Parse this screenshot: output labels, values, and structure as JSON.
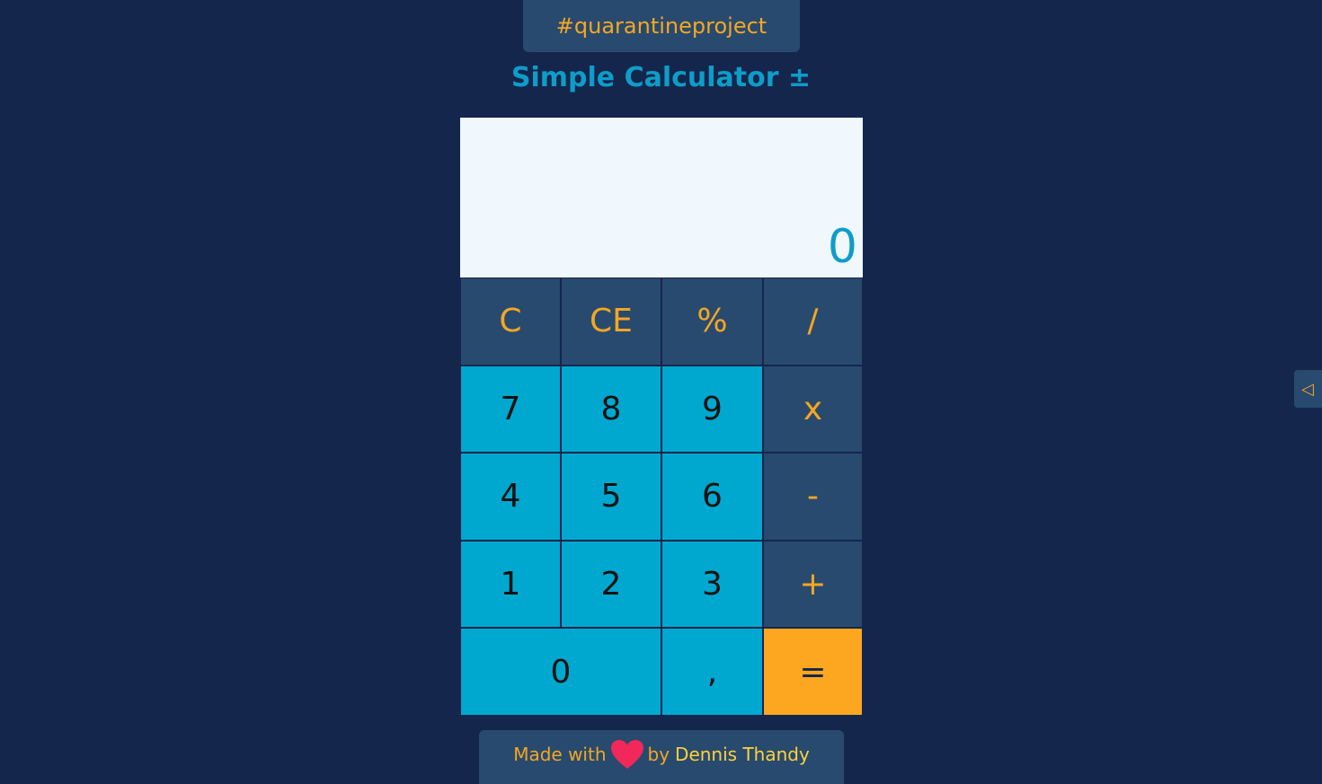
{
  "header": {
    "tag": "#quarantineproject",
    "title": "Simple Calculator ±"
  },
  "display": {
    "value": "0"
  },
  "keys": {
    "clear": "C",
    "clear_entry": "CE",
    "percent": "%",
    "divide": "/",
    "seven": "7",
    "eight": "8",
    "nine": "9",
    "multiply": "x",
    "four": "4",
    "five": "5",
    "six": "6",
    "minus": "-",
    "one": "1",
    "two": "2",
    "three": "3",
    "plus": "+",
    "zero": "0",
    "decimal": ",",
    "equals": "="
  },
  "side_toggle": {
    "icon": "triangle-left-icon",
    "glyph": "◁"
  },
  "footer": {
    "made_with": "Made with",
    "heart_icon": "heart-icon",
    "by": "by",
    "author": "Dennis Thandy"
  },
  "colors": {
    "background": "#15264d",
    "panel": "#284a6e",
    "accent_orange": "#f5a623",
    "title_blue": "#0e9dc8",
    "number_key": "#00a8cf",
    "equals_key": "#fca71f",
    "display_bg": "#f0f8fe",
    "heart": "#f2285a"
  }
}
